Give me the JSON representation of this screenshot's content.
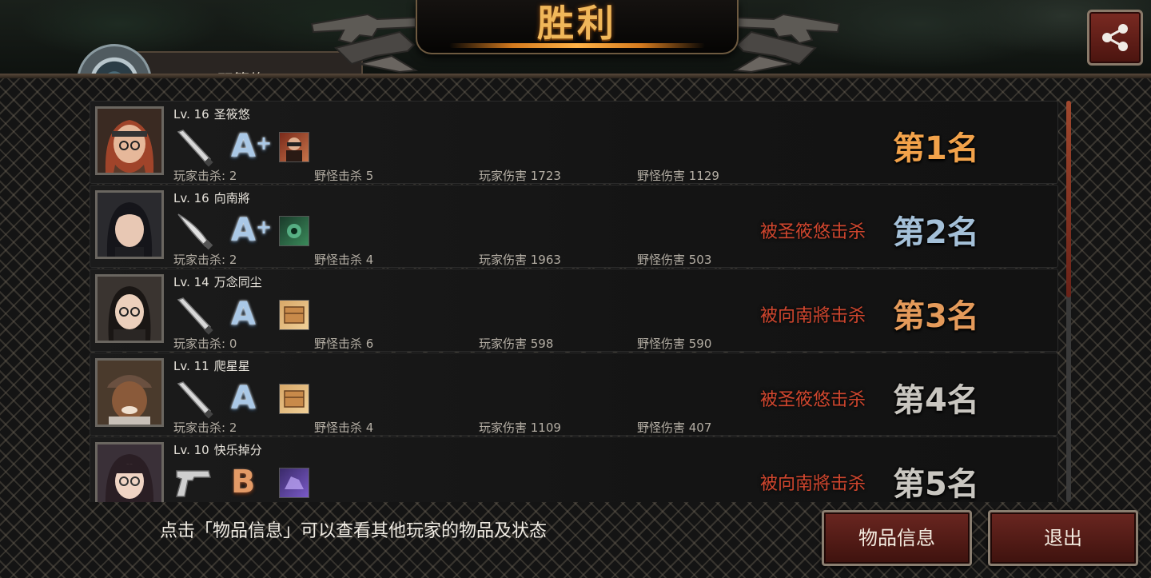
{
  "title": "胜利",
  "mode_tab": "双簧修",
  "hint": "点击「物品信息」可以查看其他玩家的物品及状态",
  "buttons": {
    "item_info": "物品信息",
    "exit": "退出"
  },
  "icons": {
    "share": "share-icon",
    "weapons": [
      "bat-icon",
      "knife-icon",
      "bat-icon",
      "bat-icon",
      "pistol-icon"
    ]
  },
  "players": [
    {
      "level": "Lv. 16",
      "name": "圣筱悠",
      "grade": "A",
      "grade_plus": "+",
      "player_kills": "玩家击杀: 2",
      "monster_kills": "野怪击杀 5",
      "player_damage": "玩家伤害 1723",
      "monster_damage": "野怪伤害 1129",
      "killed_by": "",
      "rank": "第1名"
    },
    {
      "level": "Lv. 16",
      "name": "向南將",
      "grade": "A",
      "grade_plus": "+",
      "player_kills": "玩家击杀: 2",
      "monster_kills": "野怪击杀 4",
      "player_damage": "玩家伤害 1963",
      "monster_damage": "野怪伤害 503",
      "killed_by": "被圣筱悠击杀",
      "rank": "第2名"
    },
    {
      "level": "Lv. 14",
      "name": "万念同尘",
      "grade": "A",
      "grade_plus": "",
      "player_kills": "玩家击杀: 0",
      "monster_kills": "野怪击杀 6",
      "player_damage": "玩家伤害 598",
      "monster_damage": "野怪伤害 590",
      "killed_by": "被向南將击杀",
      "rank": "第3名"
    },
    {
      "level": "Lv. 11",
      "name": "爬星星",
      "grade": "A",
      "grade_plus": "",
      "player_kills": "玩家击杀: 2",
      "monster_kills": "野怪击杀 4",
      "player_damage": "玩家伤害 1109",
      "monster_damage": "野怪伤害 407",
      "killed_by": "被圣筱悠击杀",
      "rank": "第4名"
    },
    {
      "level": "Lv. 10",
      "name": "快乐掉分",
      "grade": "B",
      "grade_plus": "",
      "player_kills": "",
      "monster_kills": "",
      "player_damage": "",
      "monster_damage": "",
      "killed_by": "被向南將击杀",
      "rank": "第5名"
    }
  ]
}
